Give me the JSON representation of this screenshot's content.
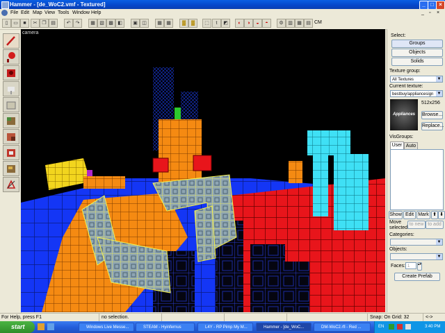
{
  "window": {
    "title": "Hammer - [de_WoC2.vmf - Textured]"
  },
  "menu": [
    "File",
    "Edit",
    "Map",
    "View",
    "Tools",
    "Window",
    "Help"
  ],
  "toolbar": {
    "cm_label": "CM"
  },
  "viewport": {
    "label": "camera"
  },
  "select_panel": {
    "title": "Select:",
    "groups": "Groups",
    "objects": "Objects",
    "solids": "Solids"
  },
  "texture": {
    "group_label": "Texture group:",
    "group_value": "All Textures",
    "current_label": "Current texture:",
    "current_value": "bestbuy/appliancesign",
    "size": "512x256",
    "preview_text": "Appliances",
    "browse": "Browse...",
    "replace": "Replace..."
  },
  "visgroups": {
    "label": "VisGroups:",
    "tab_user": "User",
    "tab_auto": "Auto",
    "show": "Show",
    "edit": "Edit",
    "mark": "Mark",
    "move_label": "Move selected:",
    "tonew": "to new",
    "toadd": "to add"
  },
  "prefab": {
    "categories_label": "Categories:",
    "objects_label": "Objects:",
    "faces_label": "Faces:",
    "faces_value": "1",
    "create": "Create Prefab"
  },
  "status": {
    "help": "For Help, press F1",
    "selection": "no selection.",
    "snap": "Snap: On Grid: 32",
    "arrows": "<->"
  },
  "taskbar": {
    "start": "start",
    "tasks": [
      "Windows Live Messe...",
      "STEAM - Hyinfernus",
      "L4Y - RP Pimp My M...",
      "Hammer - [de_WoC...",
      "DM-WoC2.rfl - Red ..."
    ],
    "lang": "EN",
    "clock": "3:40 PM"
  },
  "colors": {
    "floor_blue": "#1436f5",
    "floor_red": "#e8151b",
    "orange": "#f58a12",
    "yellow": "#f2d51e",
    "cyan": "#3fe0f5",
    "slate": "#8ea5b3",
    "select_yellow": "#f7f24c"
  }
}
